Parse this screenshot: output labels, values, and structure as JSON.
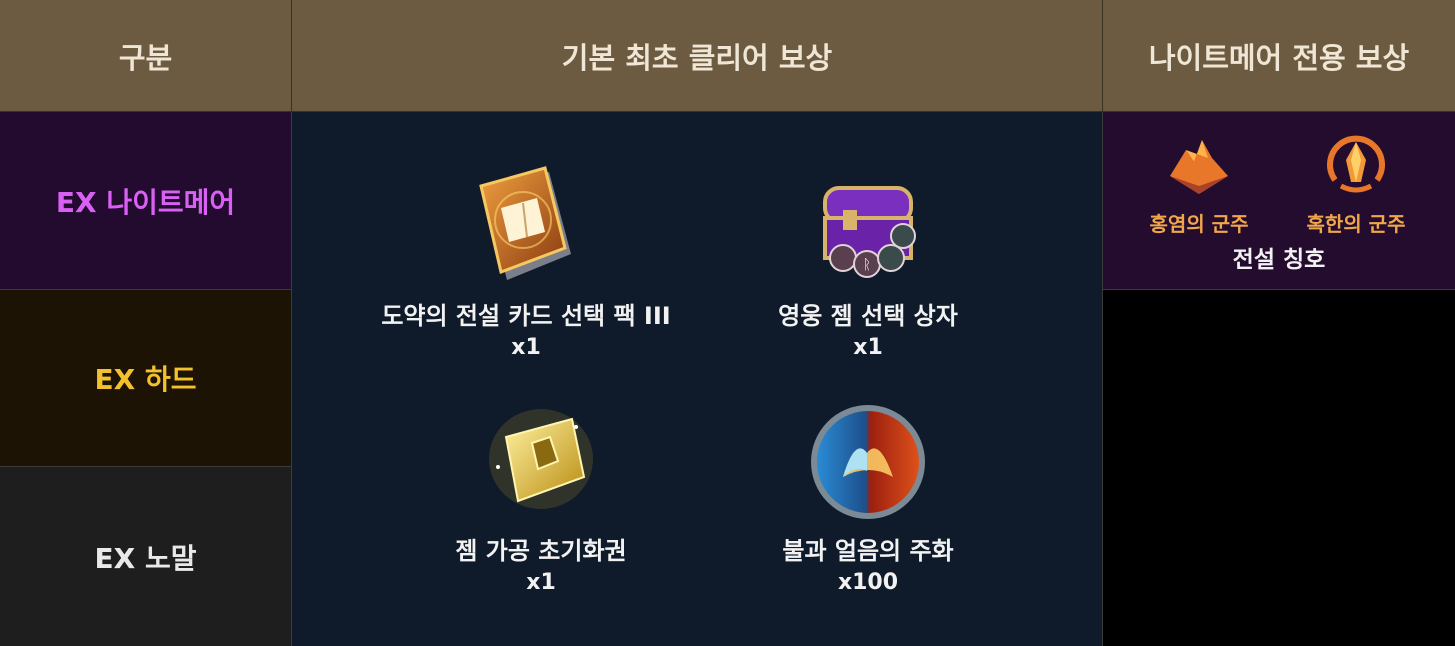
{
  "header": {
    "col_category": "구분",
    "col_base": "기본 최초 클리어 보상",
    "col_nightmare": "나이트메어 전용 보상"
  },
  "rows": [
    {
      "label": "EX 나이트메어",
      "color": "#d860f2"
    },
    {
      "label": "EX 하드",
      "color": "#f2c12c"
    },
    {
      "label": "EX 노말",
      "color": "#e9e9e9"
    }
  ],
  "base_rewards": [
    {
      "name": "도약의 전설 카드 선택 팩 III",
      "qty": "x1",
      "icon": "book-card-pack-icon"
    },
    {
      "name": "영웅 젬 선택 상자",
      "qty": "x1",
      "icon": "gem-chest-icon"
    },
    {
      "name": "젬 가공 초기화권",
      "qty": "x1",
      "icon": "golden-ticket-icon"
    },
    {
      "name": "불과 얼음의 주화",
      "qty": "x100",
      "icon": "fire-ice-coin-icon"
    }
  ],
  "nightmare_rewards": {
    "titles": [
      {
        "name": "홍염의 군주",
        "icon": "crimson-mountain-emblem-icon"
      },
      {
        "name": "혹한의 군주",
        "icon": "frost-crystal-emblem-icon"
      }
    ],
    "caption": "전설 칭호"
  },
  "colors": {
    "header_bg": "#6c5b41",
    "panel_bg": "#0f1b2a",
    "title_text": "#f0a64a"
  }
}
